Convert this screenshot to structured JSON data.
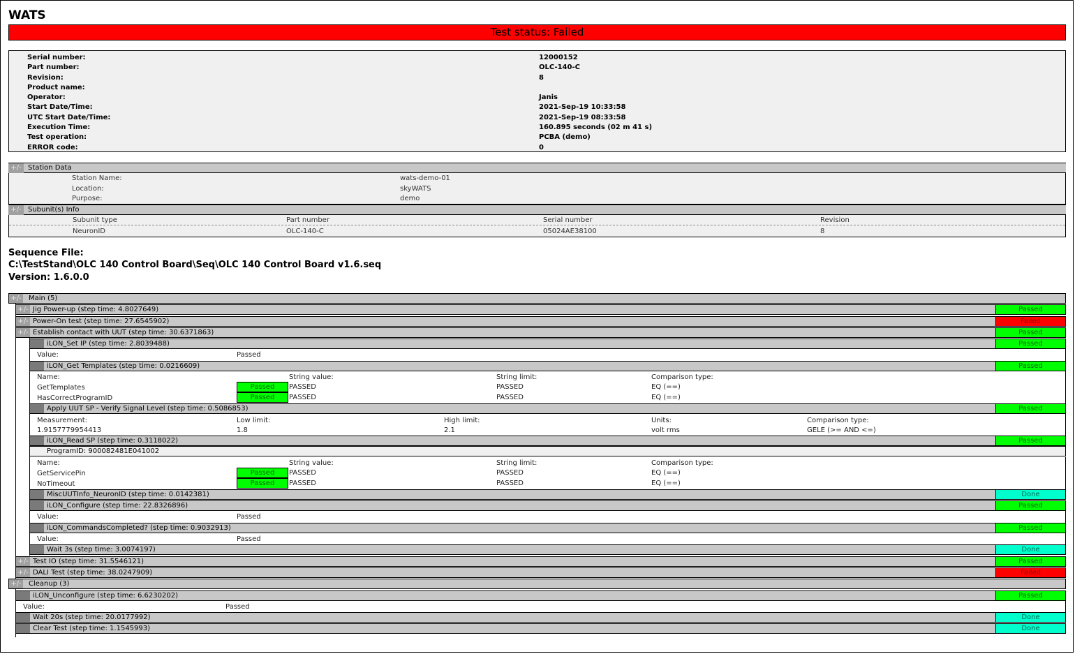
{
  "app_title": "WATS",
  "status_banner": "Test status: Failed",
  "summary": [
    {
      "label": "Serial number:",
      "value": "12000152"
    },
    {
      "label": "Part number:",
      "value": "OLC-140-C"
    },
    {
      "label": "Revision:",
      "value": "8"
    },
    {
      "label": "Product name:",
      "value": ""
    },
    {
      "label": "Operator:",
      "value": "Janis"
    },
    {
      "label": "Start Date/Time:",
      "value": "2021-Sep-19 10:33:58"
    },
    {
      "label": "UTC Start Date/Time:",
      "value": "2021-Sep-19 08:33:58"
    },
    {
      "label": "Execution Time:",
      "value": "160.895 seconds (02 m 41 s)"
    },
    {
      "label": "Test operation:",
      "value": "PCBA (demo)"
    },
    {
      "label": "ERROR code:",
      "value": "0"
    }
  ],
  "toggle_label": "+/-",
  "station": {
    "title": "Station Data",
    "rows": [
      {
        "label": "Station Name:",
        "value": "wats-demo-01"
      },
      {
        "label": "Location:",
        "value": "skyWATS"
      },
      {
        "label": "Purpose:",
        "value": "demo"
      }
    ]
  },
  "subunit": {
    "title": "Subunit(s) Info",
    "headers": [
      "Subunit type",
      "Part number",
      "Serial number",
      "Revision"
    ],
    "row": [
      "NeuronID",
      "OLC-140-C",
      "05024AE38100",
      "8"
    ]
  },
  "sequence": {
    "file_label": "Sequence File:",
    "file_path": "C:\\TestStand\\OLC 140 Control Board\\Seq\\OLC 140 Control Board v1.6.seq",
    "version": "Version: 1.6.0.0"
  },
  "steps": {
    "main": "Main (5)",
    "jig": "Jig Power-up (step time: 4.8027649)",
    "power_on": "Power-On test (step time: 27.6545902)",
    "establish": "Establish contact with UUT (step time: 30.6371863)",
    "set_ip": "iLON_Set IP (step time: 2.8039488)",
    "get_templates": "iLON_Get Templates (step time: 0.0216609)",
    "apply_sp": "Apply UUT SP - Verify Signal Level (step time: 0.5086853)",
    "read_sp": "iLON_Read SP (step time: 0.3118022)",
    "program_id": "ProgramID: 900082481E041002",
    "misc_info": "MiscUUTInfo_NeuronID (step time: 0.0142381)",
    "configure": "iLON_Configure (step time: 22.8326896)",
    "commands": "iLON_CommandsCompleted? (step time: 0.9032913)",
    "wait3": "Wait 3s (step time: 3.0074197)",
    "test_io": "Test IO (step time: 31.5546121)",
    "dali": "DALI Test (step time: 38.0247909)",
    "cleanup": "Cleanup (3)",
    "unconfigure": "iLON_Unconfigure (step time: 6.6230202)",
    "wait20": "Wait 20s (step time: 20.0177992)",
    "clear": "Clear Test (step time: 1.1545993)"
  },
  "status": {
    "passed": "Passed",
    "failed": "Failed",
    "done": "Done"
  },
  "labels": {
    "value": "Value:",
    "name": "Name:",
    "string_value": "String value:",
    "string_limit": "String limit:",
    "comparison_type": "Comparison type:",
    "measurement": "Measurement:",
    "low_limit": "Low limit:",
    "high_limit": "High limit:",
    "units": "Units:"
  },
  "value_passed": "Passed",
  "templates_table": [
    {
      "name": "GetTemplates",
      "status": "Passed",
      "value": "PASSED",
      "limit": "PASSED",
      "comp": "EQ (==)"
    },
    {
      "name": "HasCorrectProgramID",
      "status": "Passed",
      "value": "PASSED",
      "limit": "PASSED",
      "comp": "EQ (==)"
    }
  ],
  "measurement": {
    "value": "1.9157779954413",
    "low": "1.8",
    "high": "2.1",
    "units": "volt rms",
    "comp": "GELE (>= AND <=)"
  },
  "readsp_table": [
    {
      "name": "GetServicePin",
      "status": "Passed",
      "value": "PASSED",
      "limit": "PASSED",
      "comp": "EQ (==)"
    },
    {
      "name": "NoTimeout",
      "status": "Passed",
      "value": "PASSED",
      "limit": "PASSED",
      "comp": "EQ (==)"
    }
  ]
}
